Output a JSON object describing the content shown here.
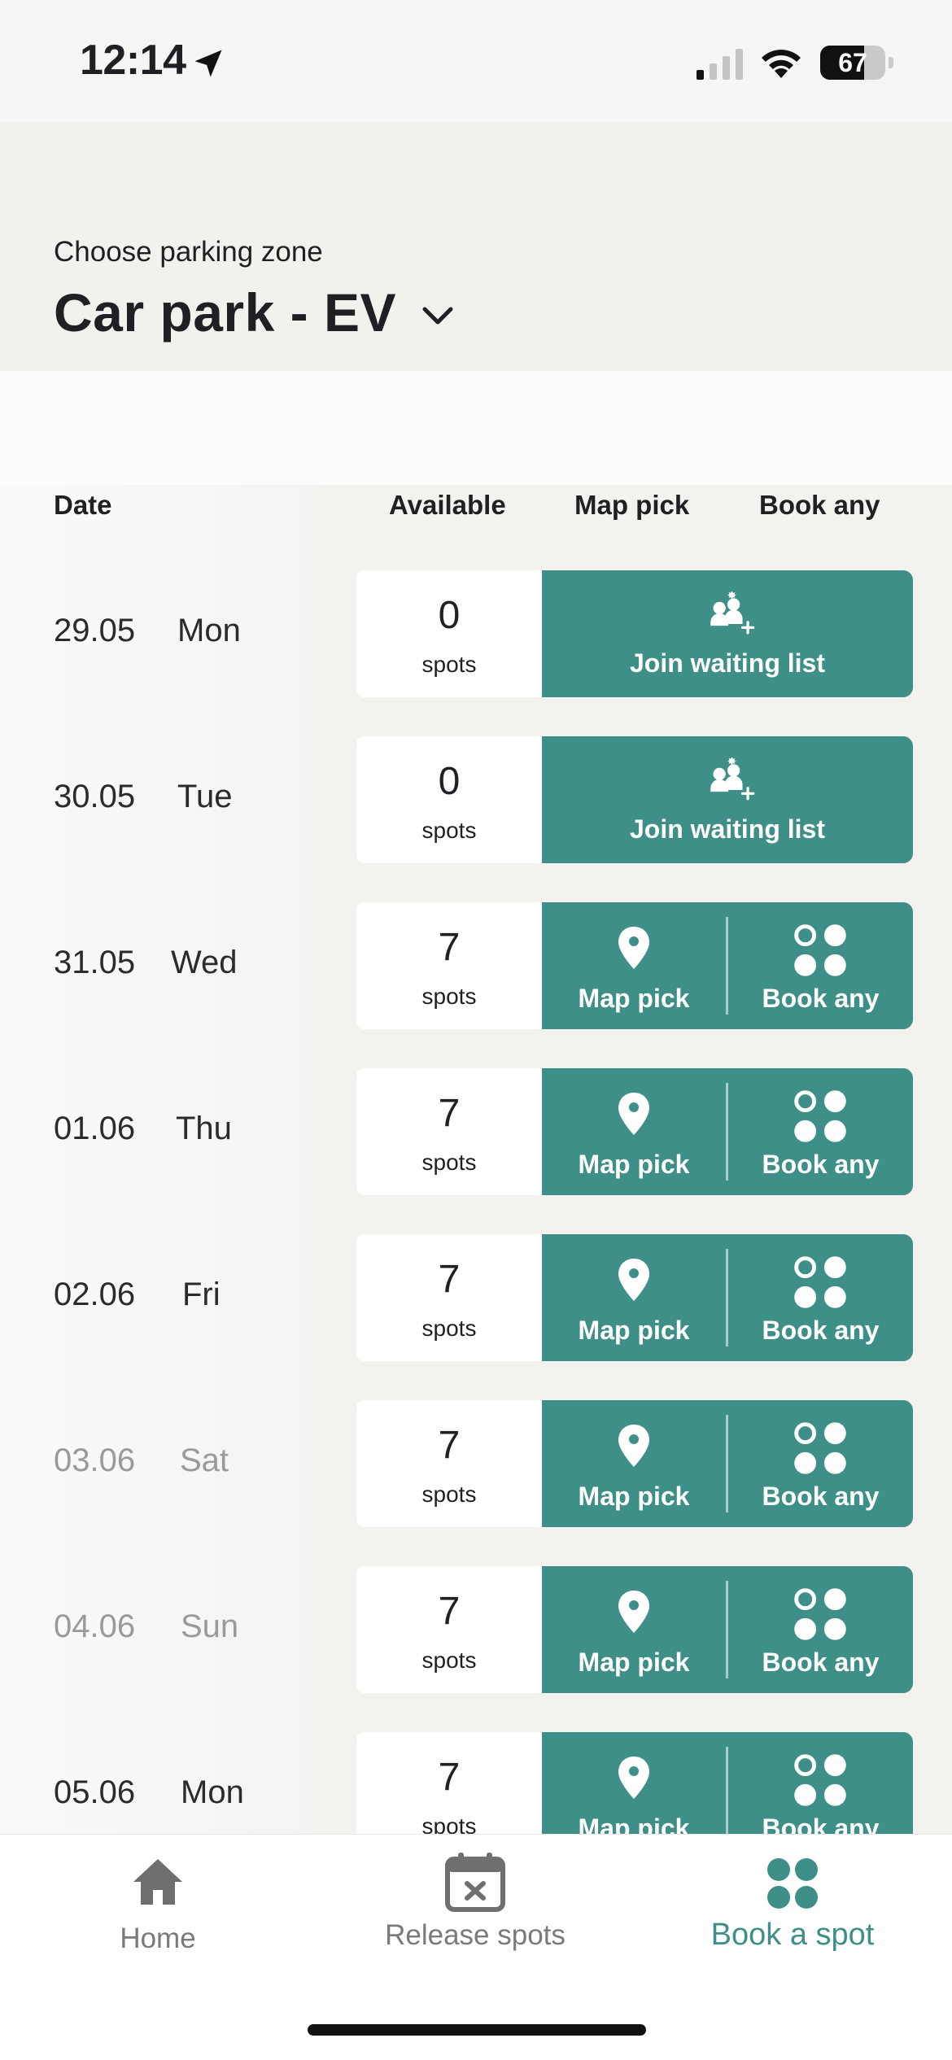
{
  "status_bar": {
    "time": "12:14",
    "battery": "67",
    "battery_level": 0.67,
    "signal_bars_active": 1,
    "icons": [
      "location-arrow-icon",
      "cellular-signal-icon",
      "wifi-icon",
      "battery-icon"
    ]
  },
  "header": {
    "zone_label": "Choose parking zone",
    "zone_title": "Car park - EV",
    "zone_chevron_icon": "chevron-down-icon"
  },
  "table": {
    "headers": {
      "date": "Date",
      "available": "Available",
      "map_pick": "Map pick",
      "book_any": "Book any"
    },
    "rows": [
      {
        "date": "29.05",
        "day": "Mon",
        "available": "0",
        "unit": "spots",
        "weekend": false,
        "action": "waiting",
        "waiting_label": "Join waiting list"
      },
      {
        "date": "30.05",
        "day": "Tue",
        "available": "0",
        "unit": "spots",
        "weekend": false,
        "action": "waiting",
        "waiting_label": "Join waiting list"
      },
      {
        "date": "31.05",
        "day": "Wed",
        "available": "7",
        "unit": "spots",
        "weekend": false,
        "action": "book",
        "map_label": "Map pick",
        "any_label": "Book any"
      },
      {
        "date": "01.06",
        "day": "Thu",
        "available": "7",
        "unit": "spots",
        "weekend": false,
        "action": "book",
        "map_label": "Map pick",
        "any_label": "Book any"
      },
      {
        "date": "02.06",
        "day": "Fri",
        "available": "7",
        "unit": "spots",
        "weekend": false,
        "action": "book",
        "map_label": "Map pick",
        "any_label": "Book any"
      },
      {
        "date": "03.06",
        "day": "Sat",
        "available": "7",
        "unit": "spots",
        "weekend": true,
        "action": "book",
        "map_label": "Map pick",
        "any_label": "Book any"
      },
      {
        "date": "04.06",
        "day": "Sun",
        "available": "7",
        "unit": "spots",
        "weekend": true,
        "action": "book",
        "map_label": "Map pick",
        "any_label": "Book any"
      },
      {
        "date": "05.06",
        "day": "Mon",
        "available": "7",
        "unit": "spots",
        "weekend": false,
        "action": "book",
        "map_label": "Map pick",
        "any_label": "Book any"
      }
    ]
  },
  "tab_bar": {
    "tabs": [
      {
        "label": "Home",
        "icon": "home-icon",
        "active": false
      },
      {
        "label": "Release spots",
        "icon": "calendar-x-icon",
        "active": false
      },
      {
        "label": "Book a spot",
        "icon": "four-dots-icon",
        "active": true
      }
    ]
  },
  "colors": {
    "accent": "#3e8f88",
    "text": "#1f2023",
    "muted": "#9a9a9a",
    "tab_inactive": "#7a7a7a"
  }
}
